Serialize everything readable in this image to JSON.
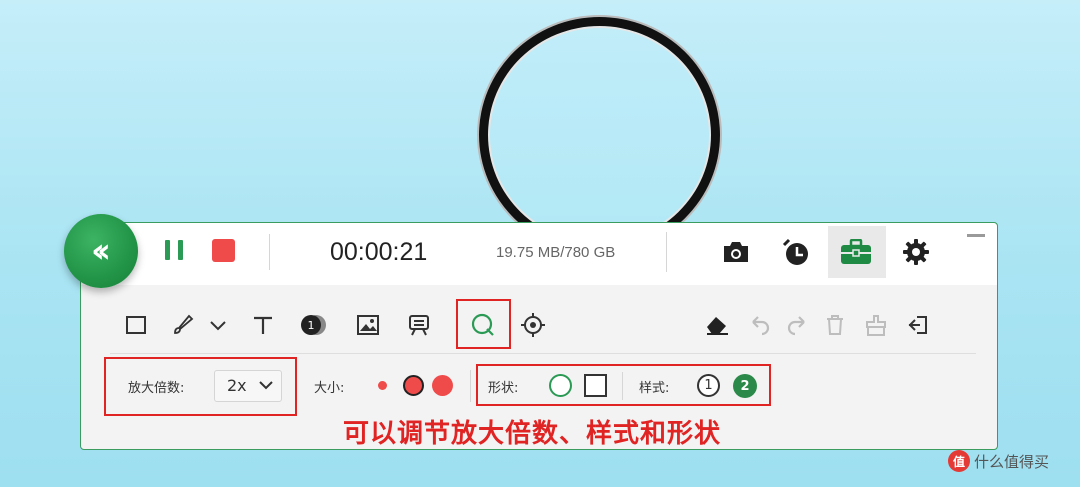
{
  "recorder": {
    "collapse_glyph": "‹‹",
    "timer": "00:00:21",
    "file_size": "19.75 MB/780 GB"
  },
  "toolbar_icons": [
    "rectangle-icon",
    "brush-icon",
    "chevron-down-icon",
    "text-icon",
    "number-marker-icon",
    "image-icon",
    "whiteboard-icon",
    "magnifier-icon",
    "spotlight-icon",
    "eraser-icon",
    "undo-icon",
    "redo-icon",
    "delete-icon",
    "clear-icon",
    "exit-icon"
  ],
  "top_icons": [
    "camera-icon",
    "schedule-icon",
    "toolbox-icon",
    "settings-icon"
  ],
  "options": {
    "zoom_label": "放大倍数:",
    "zoom_value": "2x",
    "size_label": "大小:",
    "shape_label": "形状:",
    "style_label": "样式:",
    "style_1": "1",
    "style_2": "2"
  },
  "annotation": "可以调节放大倍数、样式和形状",
  "watermark": {
    "logo": "值",
    "text": "什么值得买"
  },
  "colors": {
    "accent_green": "#2b9a55",
    "record_red": "#ef4b4b",
    "annotation_red": "#e02424"
  }
}
